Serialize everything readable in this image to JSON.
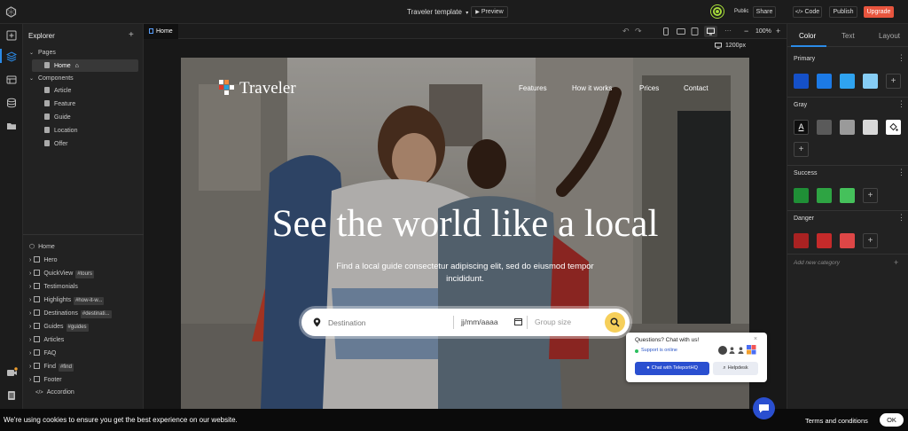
{
  "topbar": {
    "project_title": "Traveler template",
    "preview_label": "Preview",
    "visibility_label": "Public",
    "share_label": "Share",
    "code_label": "Code",
    "publish_label": "Publish",
    "upgrade_label": "Upgrade",
    "upgrade_color": "#e8553e"
  },
  "explorer": {
    "title": "Explorer",
    "pages_label": "Pages",
    "pages": [
      {
        "label": "Home"
      }
    ],
    "components_label": "Components",
    "components": [
      {
        "label": "Article"
      },
      {
        "label": "Feature"
      },
      {
        "label": "Guide"
      },
      {
        "label": "Location"
      },
      {
        "label": "Offer"
      }
    ]
  },
  "layers": {
    "root": "Home",
    "items": [
      {
        "label": "Hero",
        "tag": ""
      },
      {
        "label": "QuickView",
        "tag": "#tours"
      },
      {
        "label": "Testimonials",
        "tag": ""
      },
      {
        "label": "Highlights",
        "tag": "#how-it-w..."
      },
      {
        "label": "Destinations",
        "tag": "#destinati..."
      },
      {
        "label": "Guides",
        "tag": "#guides"
      },
      {
        "label": "Articles",
        "tag": ""
      },
      {
        "label": "FAQ",
        "tag": ""
      },
      {
        "label": "Find",
        "tag": "#find"
      },
      {
        "label": "Footer",
        "tag": ""
      },
      {
        "label": "Accordion",
        "tag": ""
      }
    ]
  },
  "canvas": {
    "tab_label": "Home",
    "zoom": "100%",
    "width_label": "1200px"
  },
  "site": {
    "logo_text": "Traveler",
    "nav": [
      "Features",
      "How it works",
      "Prices",
      "Contact"
    ],
    "hero_title": "See the world like a local",
    "hero_subtitle_line1": "Find a local guide consectetur adipiscing elit, sed do eiusmod tempor",
    "hero_subtitle_line2": "incididunt.",
    "search_destination_placeholder": "Destination",
    "search_date_placeholder": "jj/mm/aaaa",
    "search_group_placeholder": "Group size"
  },
  "chat": {
    "title": "Questions? Chat with us!",
    "status": "Support is online",
    "chat_button": "Chat with TeleportHQ",
    "helpdesk_button": "Helpdesk"
  },
  "rightpanel": {
    "tabs": [
      "Color",
      "Text",
      "Layout"
    ],
    "categories": {
      "primary": {
        "label": "Primary",
        "colors": [
          "#1550c8",
          "#1c7ae6",
          "#2fa3f0",
          "#86cdf5"
        ]
      },
      "gray": {
        "label": "Gray",
        "colors": [
          "#0e0e0e",
          "#5a5a5a",
          "#9a9a9a",
          "#d8d8d8",
          "#ffffff"
        ]
      },
      "success": {
        "label": "Success",
        "colors": [
          "#1f8f36",
          "#2ea443",
          "#45c15b"
        ]
      },
      "danger": {
        "label": "Danger",
        "colors": [
          "#a92222",
          "#c52a2a",
          "#de4646"
        ]
      }
    },
    "add_category": "Add new category"
  },
  "cookie": {
    "message": "We're using cookies to ensure you get the best experience on our website.",
    "terms_label": "Terms and conditions",
    "ok_label": "OK"
  }
}
